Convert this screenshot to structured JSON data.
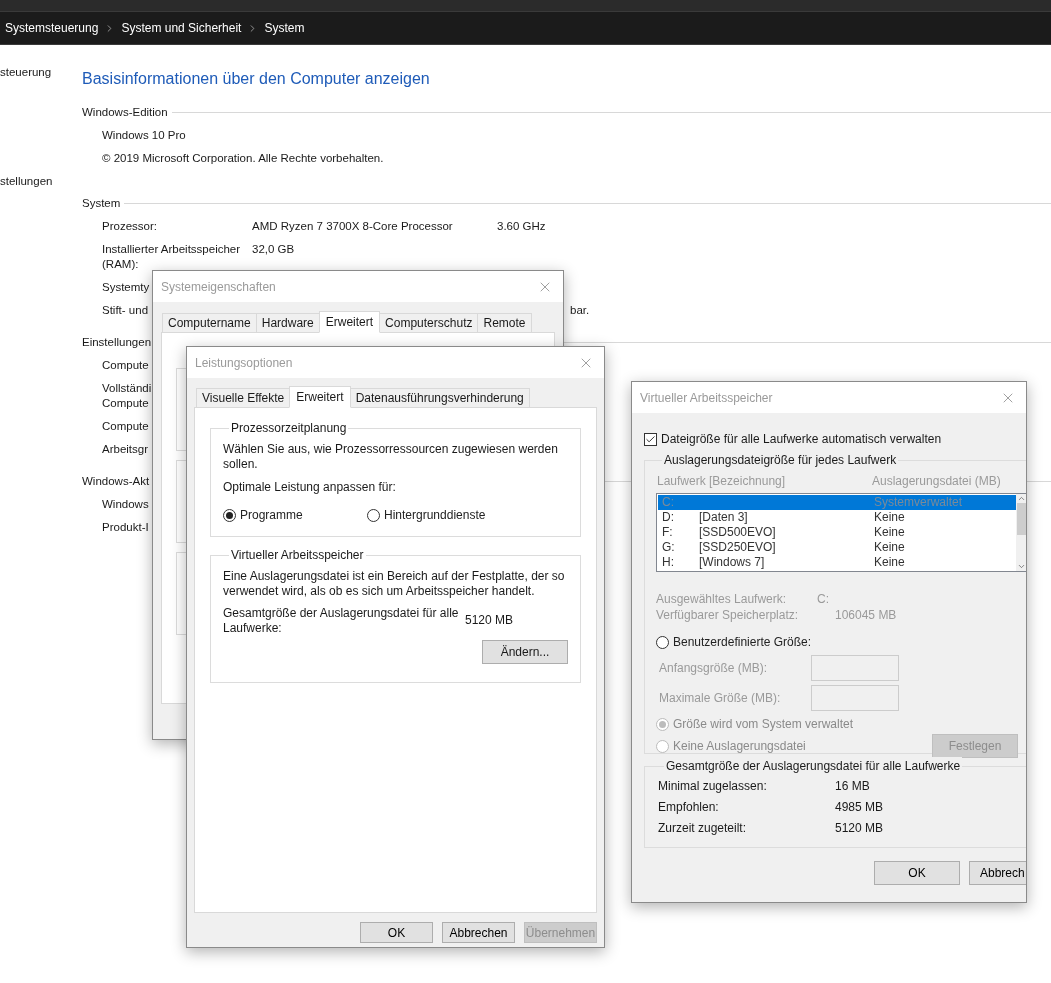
{
  "breadcrumb": [
    "Systemsteuerung",
    "System und Sicherheit",
    "System"
  ],
  "sidebar_links": [
    "steuerung",
    "stellungen"
  ],
  "page_title": "Basisinformationen über den Computer anzeigen",
  "sections": [
    {
      "heading": "Windows-Edition",
      "rows": [
        {
          "label": "Windows 10 Pro"
        },
        {
          "label": "© 2019 Microsoft Corporation. Alle Rechte vorbehalten."
        }
      ]
    },
    {
      "heading": "System",
      "rows": [
        {
          "label": "Prozessor:",
          "value": "AMD Ryzen 7 3700X 8-Core Processor",
          "extra": "3.60 GHz"
        },
        {
          "label": "Installierter Arbeitsspeicher (RAM):",
          "value": "32,0 GB"
        },
        {
          "label": "Systemty"
        },
        {
          "label": "Stift- und",
          "tail": "bar."
        }
      ]
    },
    {
      "heading": "Einstellungen",
      "rows": [
        {
          "label": "Compute"
        },
        {
          "label": "Vollständi\nCompute"
        },
        {
          "label": "Compute"
        },
        {
          "label": "Arbeitsgr"
        }
      ]
    },
    {
      "heading": "Windows-Akt",
      "rows": [
        {
          "label": "Windows"
        },
        {
          "label": "Produkt-I"
        }
      ]
    }
  ],
  "system_properties": {
    "title": "Systemeigenschaften",
    "tabs": [
      {
        "label": "Computername",
        "selected": false
      },
      {
        "label": "Hardware",
        "selected": false
      },
      {
        "label": "Erweitert",
        "selected": true
      },
      {
        "label": "Computerschutz",
        "selected": false
      },
      {
        "label": "Remote",
        "selected": false
      }
    ],
    "groups": [
      {
        "kind": "group"
      },
      {
        "kind": "group"
      },
      {
        "kind": "group"
      }
    ]
  },
  "performance_options": {
    "title": "Leistungsoptionen",
    "tabs": [
      {
        "label": "Visuelle Effekte",
        "selected": false
      },
      {
        "label": "Erweitert",
        "selected": true
      },
      {
        "label": "Datenausführungsverhinderung",
        "selected": false
      }
    ],
    "scheduling": {
      "legend": "Prozessorzeitplanung",
      "description": "Wählen Sie aus, wie Prozessorressourcen zugewiesen werden sollen.",
      "prompt": "Optimale Leistung anpassen für:",
      "radios": [
        {
          "label": "Programme",
          "selected": true
        },
        {
          "label": "Hintergrunddienste",
          "selected": false
        }
      ]
    },
    "virtual_memory": {
      "legend": "Virtueller Arbeitsspeicher",
      "description": "Eine Auslagerungsdatei ist ein Bereich auf der Festplatte, der so verwendet wird, als ob es sich um Arbeitsspeicher handelt.",
      "total_label": "Gesamtgröße der Auslagerungsdatei für alle Laufwerke:",
      "total_value": "5120 MB",
      "change_button": "Ändern..."
    },
    "buttons": [
      {
        "label": "OK",
        "disabled": false
      },
      {
        "label": "Abbrechen",
        "disabled": false
      },
      {
        "label": "Übernehmen",
        "disabled": true
      }
    ]
  },
  "virtual_memory": {
    "title": "Virtueller Arbeitsspeicher",
    "auto_manage": {
      "label": "Dateigröße für alle Laufwerke automatisch verwalten",
      "checked": true
    },
    "per_drive": {
      "legend": "Auslagerungsdateigröße für jedes Laufwerk",
      "columns": [
        "Laufwerk [Bezeichnung]",
        "Auslagerungsdatei (MB)"
      ],
      "drives": [
        {
          "drive": "C:",
          "size": "Systemverwaltet",
          "selected": true
        },
        {
          "drive": "D:",
          "name": "[Daten 3]",
          "size": "Keine",
          "selected": false
        },
        {
          "drive": "F:",
          "name": "[SSD500EVO]",
          "size": "Keine",
          "selected": false
        },
        {
          "drive": "G:",
          "name": "[SSD250EVO]",
          "size": "Keine",
          "selected": false
        },
        {
          "drive": "H:",
          "name": "[Windows 7]",
          "size": "Keine",
          "selected": false
        }
      ],
      "info": [
        {
          "label": "Ausgewähltes Laufwerk:",
          "value": "C:"
        },
        {
          "label": "Verfügbarer Speicherplatz:",
          "value": "106045 MB"
        }
      ],
      "options": [
        {
          "kind": "radio",
          "label": "Benutzerdefinierte Größe:",
          "selected": false,
          "disabled": false
        },
        {
          "kind": "field",
          "label": "Anfangsgröße (MB):"
        },
        {
          "kind": "field",
          "label": "Maximale Größe (MB):"
        },
        {
          "kind": "radio",
          "label": "Größe wird vom System verwaltet",
          "selected": true,
          "disabled": true
        },
        {
          "kind": "radio",
          "label": "Keine Auslagerungsdatei",
          "selected": false,
          "disabled": true
        }
      ],
      "set_button": {
        "label": "Festlegen",
        "disabled": true
      }
    },
    "totals": {
      "legend": "Gesamtgröße der Auslagerungsdatei für alle Laufwerke",
      "rows": [
        {
          "label": "Minimal zugelassen:",
          "value": "16 MB"
        },
        {
          "label": "Empfohlen:",
          "value": "4985 MB"
        },
        {
          "label": "Zurzeit zugeteilt:",
          "value": "5120 MB"
        }
      ]
    },
    "buttons": [
      {
        "label": "OK",
        "disabled": false
      },
      {
        "label": "Abbrech",
        "disabled": false
      }
    ]
  }
}
